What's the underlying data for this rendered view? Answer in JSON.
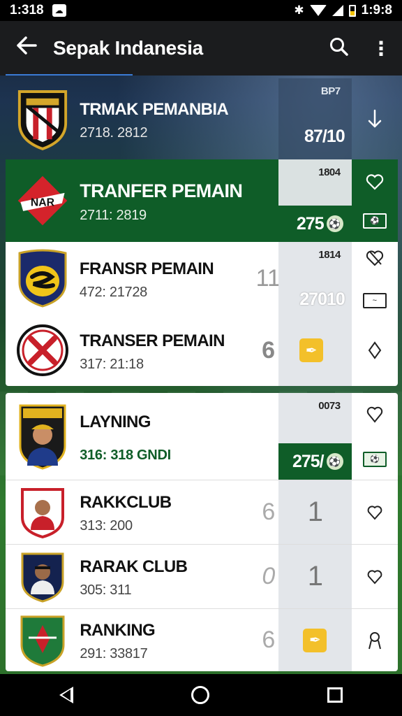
{
  "status_bar": {
    "time_left": "1:318",
    "time_right": "1:9:8"
  },
  "app_bar": {
    "title": "Sepak Indanesia"
  },
  "rows": [
    {
      "name": "TRMAK PEMANBIA",
      "sub": "2718. 2812",
      "rank": "",
      "small": "BP7",
      "value": "87/10",
      "action_icon": "arrow-down-icon"
    },
    {
      "name": "TRANFER PEMAIN",
      "sub": "2711: 2819",
      "rank": "",
      "small": "1804",
      "value": "275",
      "action_icon": "heart-icon"
    },
    {
      "name": "FRANSR PEMAIN",
      "sub": "472: 21728",
      "rank": "11",
      "small": "1814",
      "value": "27010",
      "action_icon": "heart-cross-icon"
    },
    {
      "name": "TRANSER PEMAIN",
      "sub": "317: 21:18",
      "rank": "6",
      "small": "",
      "value": "",
      "action_icon": "diamond-icon"
    },
    {
      "name": "LAYNING",
      "sub": "316: 318 GNDI",
      "rank": "",
      "small": "0073",
      "value": "275/",
      "action_icon": "heart-icon"
    },
    {
      "name": "RAKKCLUB",
      "sub": "313: 200",
      "rank": "6",
      "small": "",
      "value": "1",
      "action_icon": "heart-icon"
    },
    {
      "name": "RARAK CLUB",
      "sub": "305: 311",
      "rank": "0",
      "small": "",
      "value": "1",
      "action_icon": "heart-icon"
    },
    {
      "name": "RANKING",
      "sub": "291: 33817",
      "rank": "6",
      "small": "",
      "value": "",
      "action_icon": "ribbon-icon"
    }
  ],
  "colors": {
    "green": "#0f5d28",
    "yellow": "#f3c02a",
    "appbar": "#1b1c1e"
  }
}
